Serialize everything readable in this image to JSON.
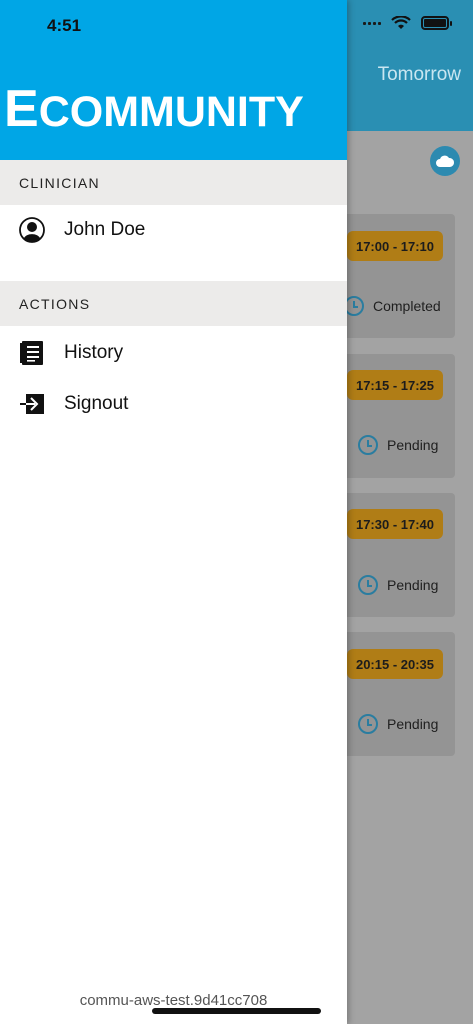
{
  "status_bar": {
    "time": "4:51"
  },
  "background": {
    "header_title": "Tomorrow",
    "appointments": [
      {
        "time": "17:00 - 17:10",
        "status": "Completed"
      },
      {
        "time": "17:15 - 17:25",
        "status": "Pending"
      },
      {
        "time": "17:30 - 17:40",
        "status": "Pending"
      },
      {
        "time": "20:15 - 20:35",
        "status": "Pending"
      }
    ]
  },
  "drawer": {
    "logo_lead": "E",
    "logo_rest": "COMMUNITY",
    "sections": [
      {
        "title": "CLINICIAN",
        "items": [
          {
            "label": "John Doe",
            "icon": "user-icon"
          }
        ]
      },
      {
        "title": "ACTIONS",
        "items": [
          {
            "label": "History",
            "icon": "history-icon"
          },
          {
            "label": "Signout",
            "icon": "signout-icon"
          }
        ]
      }
    ],
    "version": "commu-aws-test.9d41cc708"
  },
  "colors": {
    "brand": "#00a6e6",
    "pill": "#b07d16",
    "section_bg": "#ecebea"
  }
}
